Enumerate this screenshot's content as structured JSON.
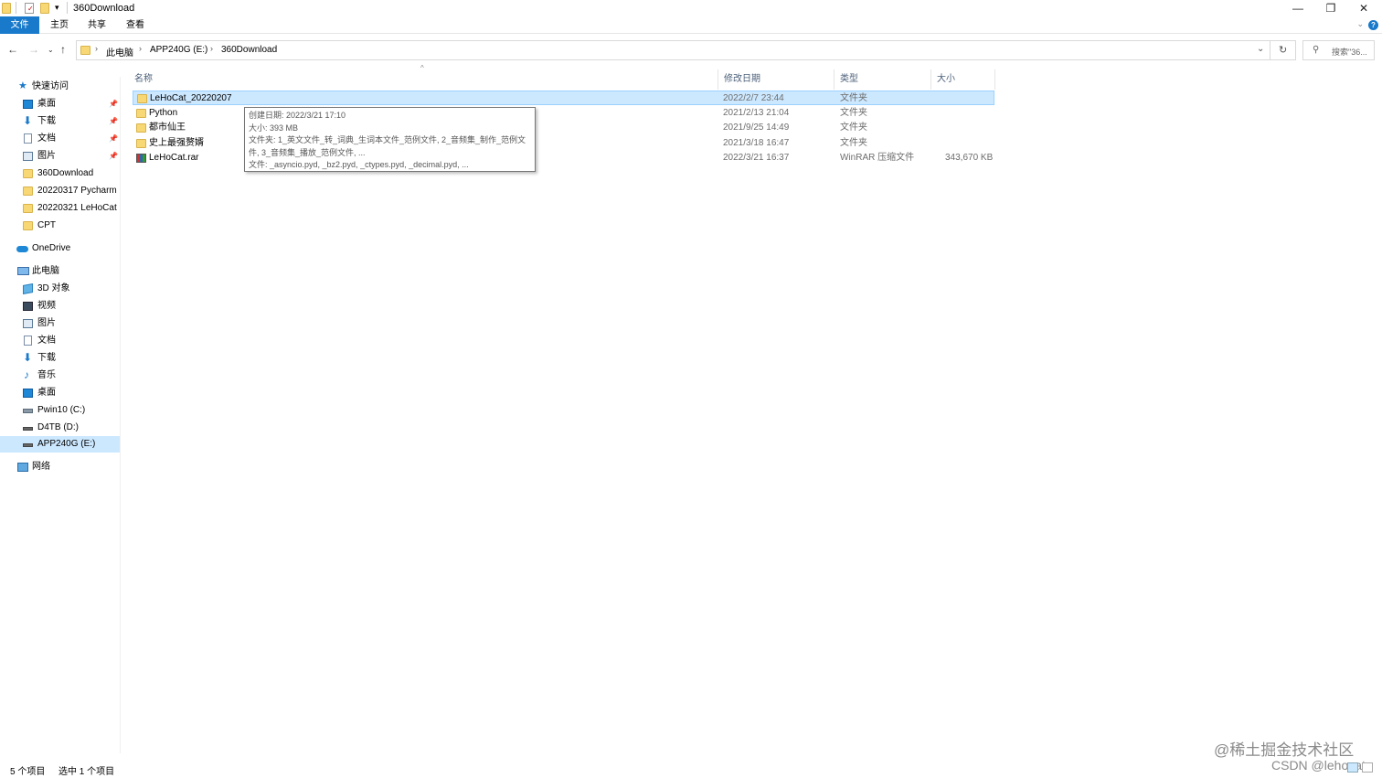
{
  "window": {
    "title": "360Download",
    "controls": {
      "minimize": "—",
      "restore": "❐",
      "close": "✕"
    }
  },
  "ribbon": {
    "tabs": [
      {
        "label": "文件"
      },
      {
        "label": "主页"
      },
      {
        "label": "共享"
      },
      {
        "label": "查看"
      }
    ],
    "help": "?"
  },
  "address": {
    "crumbs": [
      "此电脑",
      "APP240G (E:)",
      "360Download"
    ],
    "search_placeholder": "搜索\"36..."
  },
  "sidebar": {
    "quick_access": "快速访问",
    "quick_items": [
      {
        "label": "桌面",
        "icon": "desktop-icon",
        "pinned": true
      },
      {
        "label": "下载",
        "icon": "download-icon",
        "pinned": true
      },
      {
        "label": "文档",
        "icon": "document-icon",
        "pinned": true
      },
      {
        "label": "图片",
        "icon": "pictures-icon",
        "pinned": true
      },
      {
        "label": "360Download",
        "icon": "folder-icon",
        "pinned": false
      },
      {
        "label": "20220317 Pycharm",
        "icon": "folder-icon",
        "pinned": false
      },
      {
        "label": "20220321 LeHoCat",
        "icon": "folder-icon",
        "pinned": false
      },
      {
        "label": "CPT",
        "icon": "folder-icon",
        "pinned": false
      }
    ],
    "onedrive": "OneDrive",
    "this_pc": "此电脑",
    "pc_items": [
      {
        "label": "3D 对象",
        "icon": "3d-objects-icon"
      },
      {
        "label": "视频",
        "icon": "video-icon"
      },
      {
        "label": "图片",
        "icon": "pictures-icon"
      },
      {
        "label": "文档",
        "icon": "document-icon"
      },
      {
        "label": "下载",
        "icon": "download-icon"
      },
      {
        "label": "音乐",
        "icon": "music-icon"
      },
      {
        "label": "桌面",
        "icon": "desktop-icon"
      },
      {
        "label": "Pwin10 (C:)",
        "icon": "drive-icon"
      },
      {
        "label": "D4TB (D:)",
        "icon": "drive-icon"
      },
      {
        "label": "APP240G (E:)",
        "icon": "drive-icon",
        "selected": true
      }
    ],
    "network": "网络"
  },
  "columns": {
    "name": "名称",
    "modified": "修改日期",
    "type": "类型",
    "size": "大小"
  },
  "files": [
    {
      "name": "LeHoCat_20220207",
      "modified": "2022/2/7 23:44",
      "type": "文件夹",
      "size": "",
      "kind": "folder",
      "selected": true
    },
    {
      "name": "Python",
      "modified": "2021/2/13 21:04",
      "type": "文件夹",
      "size": "",
      "kind": "folder"
    },
    {
      "name": "都市仙王",
      "modified": "2021/9/25 14:49",
      "type": "文件夹",
      "size": "",
      "kind": "folder"
    },
    {
      "name": "史上最强赘婿",
      "modified": "2021/3/18 16:47",
      "type": "文件夹",
      "size": "",
      "kind": "folder"
    },
    {
      "name": "LeHoCat.rar",
      "modified": "2022/3/21 16:37",
      "type": "WinRAR 压缩文件",
      "size": "343,670 KB",
      "kind": "rar"
    }
  ],
  "tooltip": {
    "line1": "创建日期: 2022/3/21 17:10",
    "line2": "大小: 393 MB",
    "line3": "文件夹: 1_英文文件_转_词典_生词本文件_范例文件, 2_音频集_制作_范例文",
    "line4": "件, 3_音频集_播放_范例文件, ...",
    "line5": "文件: _asyncio.pyd, _bz2.pyd, _ctypes.pyd, _decimal.pyd, ..."
  },
  "status": {
    "count": "5 个项目",
    "selected": "选中 1 个项目"
  },
  "watermarks": {
    "juejin": "@稀土掘金技术社区",
    "csdn": "CSDN @lehocat"
  },
  "colors": {
    "accent": "#1979ca",
    "selection": "#cce8ff",
    "folder": "#f8d775"
  }
}
